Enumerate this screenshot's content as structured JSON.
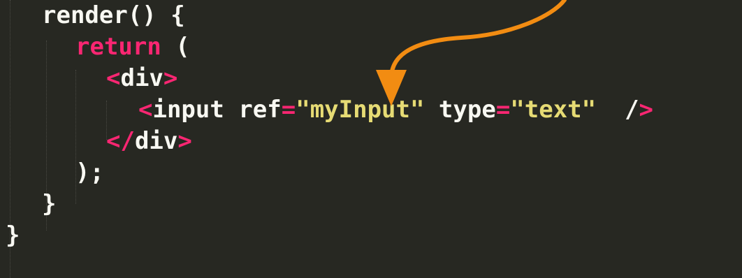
{
  "editor": {
    "theme": {
      "background": "#272822",
      "keyword": "#f92672",
      "string": "#e6db74",
      "plain": "#f8f8f2",
      "annotation": "#f28c12"
    },
    "lines": [
      {
        "tokens": [
          {
            "text": "render() {",
            "type": "plain"
          }
        ]
      },
      {
        "tokens": [
          {
            "text": "return",
            "type": "kw"
          },
          {
            "text": " (",
            "type": "plain"
          }
        ]
      },
      {
        "tokens": [
          {
            "text": "<",
            "type": "tag"
          },
          {
            "text": "div",
            "type": "plain"
          },
          {
            "text": ">",
            "type": "tag"
          }
        ]
      },
      {
        "tokens": [
          {
            "text": "<",
            "type": "tag"
          },
          {
            "text": "input ",
            "type": "plain"
          },
          {
            "text": "ref",
            "type": "attr"
          },
          {
            "text": "=",
            "type": "op"
          },
          {
            "text": "\"myInput\"",
            "type": "str"
          },
          {
            "text": " type",
            "type": "attr"
          },
          {
            "text": "=",
            "type": "op"
          },
          {
            "text": "\"text\"",
            "type": "str"
          },
          {
            "text": "  /",
            "type": "plain"
          },
          {
            "text": ">",
            "type": "tag"
          }
        ]
      },
      {
        "tokens": [
          {
            "text": "</",
            "type": "tag"
          },
          {
            "text": "div",
            "type": "plain"
          },
          {
            "text": ">",
            "type": "tag"
          }
        ]
      },
      {
        "tokens": [
          {
            "text": ");",
            "type": "plain"
          }
        ]
      },
      {
        "tokens": [
          {
            "text": "}",
            "type": "plain"
          }
        ]
      },
      {
        "tokens": [
          {
            "text": "}",
            "type": "plain"
          }
        ]
      }
    ]
  }
}
